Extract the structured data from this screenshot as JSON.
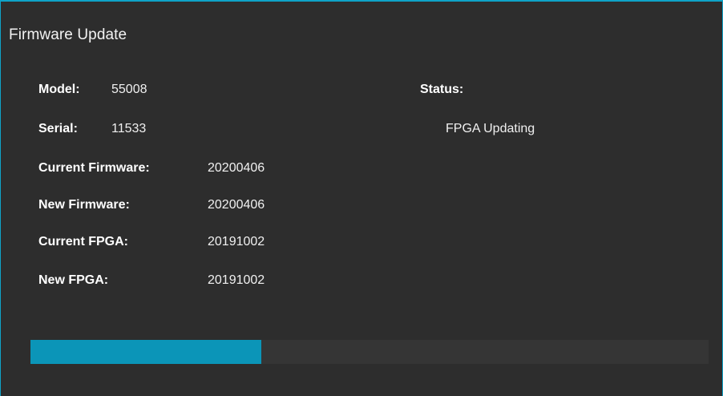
{
  "window": {
    "title": "Firmware Update"
  },
  "device": {
    "model_label": "Model:",
    "model_value": "55008",
    "serial_label": "Serial:",
    "serial_value": "11533",
    "current_firmware_label": "Current Firmware:",
    "current_firmware_value": "20200406",
    "new_firmware_label": "New Firmware:",
    "new_firmware_value": "20200406",
    "current_fpga_label": "Current FPGA:",
    "current_fpga_value": "20191002",
    "new_fpga_label": "New FPGA:",
    "new_fpga_value": "20191002"
  },
  "status": {
    "label": "Status:",
    "value": "FPGA Updating"
  },
  "progress": {
    "fraction": 0.34,
    "fill_color": "#0b95b8",
    "track_color": "#353535"
  },
  "colors": {
    "accent_border": "#0fa3c8",
    "background": "#2d2d2d"
  }
}
